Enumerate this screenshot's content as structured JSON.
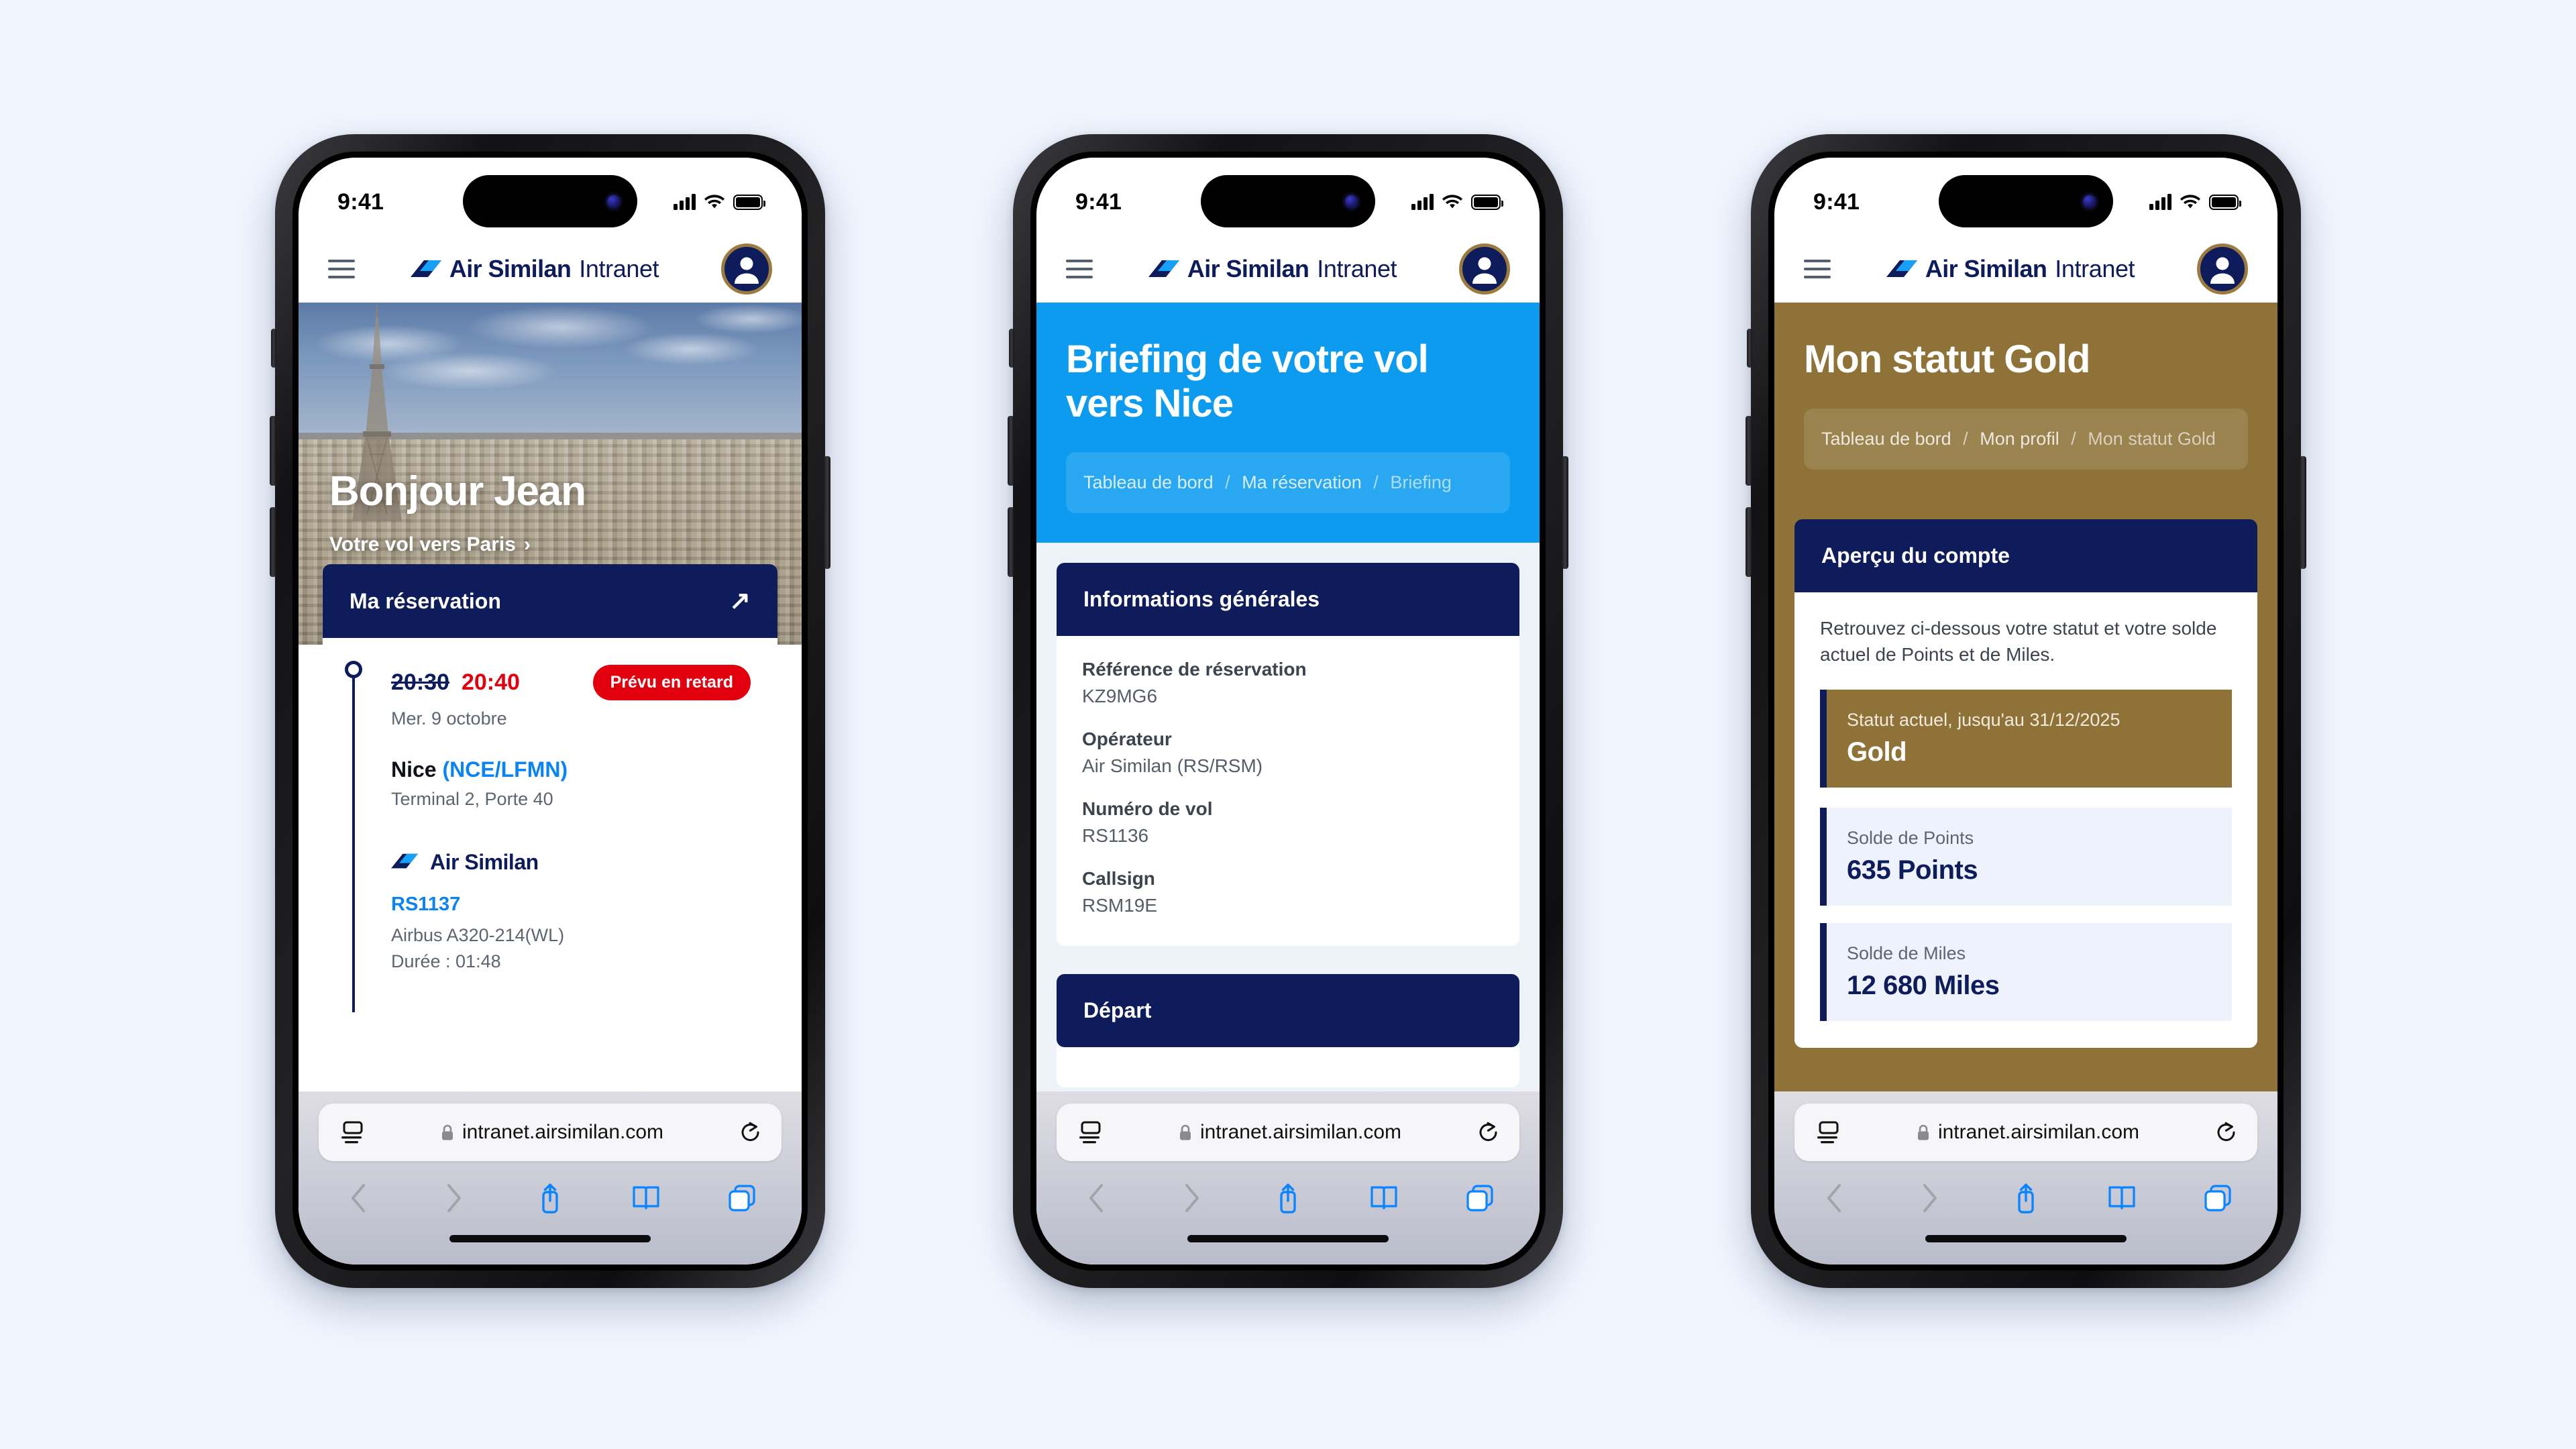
{
  "background_color": "#f0f5fe",
  "brand": {
    "name_bold": "Air Similan",
    "name_light": "Intranet",
    "navy": "#0e1c5b",
    "cyan": "#0b84f3",
    "gold": "#8e7238",
    "red": "#e2000f"
  },
  "status_bar": {
    "time": "9:41",
    "signal_icon": "cellular-signal-icon",
    "wifi_icon": "wifi-icon",
    "battery_icon": "battery-icon"
  },
  "app_header": {
    "menu_icon": "hamburger-menu-icon",
    "avatar_icon": "user-avatar-icon"
  },
  "browser": {
    "url": "intranet.airsimilan.com",
    "page_settings_icon": "page-settings-icon",
    "lock_icon": "lock-icon",
    "reload_icon": "reload-icon",
    "back_icon": "back-chevron-icon",
    "forward_icon": "forward-chevron-icon",
    "share_icon": "share-icon",
    "bookmarks_icon": "bookmarks-icon",
    "tabs_icon": "tabs-icon"
  },
  "screen1": {
    "hero": {
      "greeting": "Bonjour Jean",
      "flight_link": "Votre vol vers Paris",
      "chevron_icon": "chevron-right-icon",
      "image_alt": "paris-eiffel-tower-photo"
    },
    "reservation_card": {
      "title": "Ma réservation",
      "open_icon": "arrow-up-right-icon",
      "time_scheduled": "20:30",
      "time_actual": "20:40",
      "status_badge": "Prévu en retard",
      "date": "Mer. 9 octobre",
      "airport_city": "Nice",
      "airport_codes": "(NCE/LFMN)",
      "terminal": "Terminal 2, Porte 40",
      "operator": "Air Similan",
      "flight_number": "RS1137",
      "aircraft": "Airbus A320-214(WL)",
      "duration": "Durée : 01:48"
    }
  },
  "screen2": {
    "hero": {
      "title": "Briefing de votre vol vers Nice",
      "breadcrumb": [
        "Tableau de bord",
        "Ma réservation",
        "Briefing"
      ],
      "separator": "/"
    },
    "general_info": {
      "title": "Informations générales",
      "fields": [
        {
          "label": "Référence de réservation",
          "value": "KZ9MG6"
        },
        {
          "label": "Opérateur",
          "value": "Air Similan (RS/RSM)"
        },
        {
          "label": "Numéro de vol",
          "value": "RS1136"
        },
        {
          "label": "Callsign",
          "value": "RSM19E"
        }
      ]
    },
    "departure": {
      "title": "Départ"
    }
  },
  "screen3": {
    "hero": {
      "title": "Mon statut Gold",
      "breadcrumb": [
        "Tableau de bord",
        "Mon profil",
        "Mon statut Gold"
      ],
      "separator": "/"
    },
    "account": {
      "title": "Aperçu du compte",
      "intro": "Retrouvez ci-dessous votre statut et votre solde actuel de Points et de Miles.",
      "status_label": "Statut actuel, jusqu'au 31/12/2025",
      "status_value": "Gold",
      "points_label": "Solde de Points",
      "points_value": "635 Points",
      "miles_label": "Solde de Miles",
      "miles_value": "12 680 Miles"
    }
  }
}
